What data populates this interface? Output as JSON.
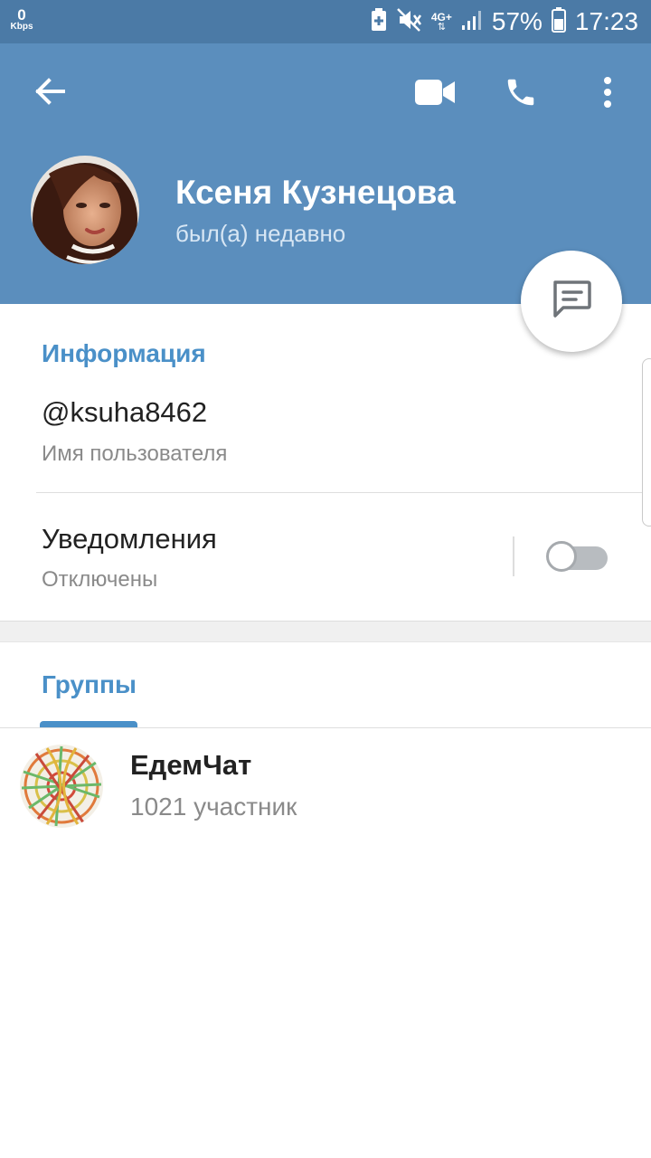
{
  "status_bar": {
    "net_speed_value": "0",
    "net_speed_unit": "Kbps",
    "network_type": "4G+",
    "battery_percent": "57%",
    "time": "17:23"
  },
  "header": {
    "back_icon": "arrow-left-icon",
    "video_call_icon": "video-camera-icon",
    "call_icon": "phone-icon",
    "menu_icon": "more-vertical-icon",
    "contact_name": "Ксеня Кузнецова",
    "last_seen": "был(а) недавно"
  },
  "fab": {
    "icon": "message-icon"
  },
  "info": {
    "section_title": "Информация",
    "username": "@ksuha8462",
    "username_label": "Имя пользователя",
    "notifications_label": "Уведомления",
    "notifications_state": "Отключены",
    "notifications_enabled": false
  },
  "groups": {
    "tab_label": "Группы",
    "items": [
      {
        "name": "ЕдемЧат",
        "members": "1021 участник"
      }
    ]
  },
  "colors": {
    "header": "#5b8ebd",
    "status_bar": "#4b7aa6",
    "accent": "#4a90c8"
  }
}
